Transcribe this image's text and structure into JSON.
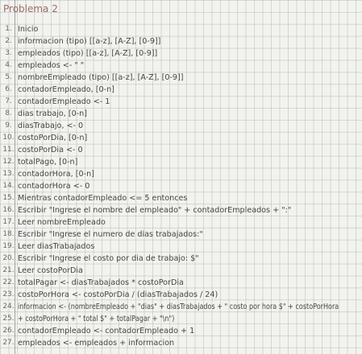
{
  "title": "Problema 2",
  "lines": [
    {
      "num": "1.",
      "text": "Inicio"
    },
    {
      "num": "2.",
      "text": "informacion (tipo) [[a-z], [A-Z], [0-9]]"
    },
    {
      "num": "3.",
      "text": "empleados (tipo) [[a-z], [A-Z], [0-9]]"
    },
    {
      "num": "4.",
      "text": "empleados <- \" \""
    },
    {
      "num": "5.",
      "text": "nombreEmpleado (tipo) [[a-z], [A-Z], [0-9]]"
    },
    {
      "num": "6.",
      "text": "contadorEmpleado, [0-n]"
    },
    {
      "num": "7.",
      "text": "contadorEmpleado <- 1"
    },
    {
      "num": "8.",
      "text": "dias trabajo, [0-n]"
    },
    {
      "num": "9.",
      "text": "diasTrabajo, <- 0"
    },
    {
      "num": "10.",
      "text": "costoPorDia, [0-n]"
    },
    {
      "num": "11.",
      "text": "costoPorDia <- 0"
    },
    {
      "num": "12.",
      "text": "totalPago, [0-n]"
    },
    {
      "num": "13.",
      "text": "contadorHora, [0-n]"
    },
    {
      "num": "14.",
      "text": "contadorHora <- 0"
    },
    {
      "num": "15.",
      "text": "Mientras contadorEmpleado <= 5 entonces"
    },
    {
      "num": "16.",
      "text": "Escribir \"Ingrese el nombre del empleado\" + contadorEmpleados + \":\""
    },
    {
      "num": "17.",
      "text": "Leer nombreEmpleado"
    },
    {
      "num": "18.",
      "text": "Escribir \"Ingrese el numero de dias trabajados:\""
    },
    {
      "num": "19.",
      "text": "Leer diasTrabajados"
    },
    {
      "num": "20.",
      "text": "Escribir \"Ingrese el costo por dia de trabajo: $\""
    },
    {
      "num": "21.",
      "text": "Leer costoPorDia"
    },
    {
      "num": "22.",
      "text": "totalPagar <- diasTrabajados * costoPorDia"
    },
    {
      "num": "23.",
      "text": "costoPorHora <- costoPorDia / (diasTrabajados / 24)"
    },
    {
      "num": "24.",
      "text": "informacion <- (nombreEmpleado + \"dias\" + diasTrabajados + \" costo por hora $\" + costoPorHora"
    },
    {
      "num": "25.",
      "text": "+ costoPorHora + \" total $\" + totalPagar + \"\\n\")"
    },
    {
      "num": "26.",
      "text": "contadorEmpleado <- contadorEmpleado + 1"
    },
    {
      "num": "27.",
      "text": "empleados <- empleados + informacion"
    }
  ]
}
